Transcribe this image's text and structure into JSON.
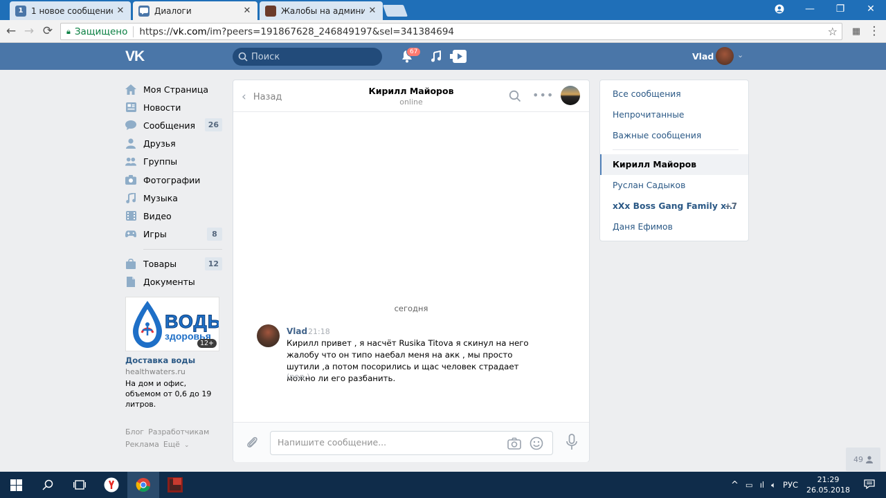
{
  "browser": {
    "tabs": [
      {
        "title": "1 новое сообщение",
        "favicon": "1"
      },
      {
        "title": "Диалоги",
        "favicon": "vk"
      },
      {
        "title": "Жалобы на администра",
        "favicon": "img"
      }
    ],
    "secure_label": "Защищено",
    "url_prefix": "https://",
    "url_host": "vk.com",
    "url_path": "/im?peers=191867628_246849197&sel=341384694"
  },
  "header": {
    "logo": "VK",
    "search_placeholder": "Поиск",
    "notifications_count": "67",
    "user_name": "Vlad"
  },
  "sidebar": {
    "items": [
      {
        "label": "Моя Страница",
        "icon": "home-icon",
        "count": ""
      },
      {
        "label": "Новости",
        "icon": "news-icon",
        "count": ""
      },
      {
        "label": "Сообщения",
        "icon": "messages-icon",
        "count": "26"
      },
      {
        "label": "Друзья",
        "icon": "friends-icon",
        "count": ""
      },
      {
        "label": "Группы",
        "icon": "groups-icon",
        "count": ""
      },
      {
        "label": "Фотографии",
        "icon": "camera-icon",
        "count": ""
      },
      {
        "label": "Музыка",
        "icon": "music-icon",
        "count": ""
      },
      {
        "label": "Видео",
        "icon": "video-icon",
        "count": ""
      },
      {
        "label": "Игры",
        "icon": "gamepad-icon",
        "count": "8"
      }
    ],
    "items2": [
      {
        "label": "Товары",
        "icon": "bag-icon",
        "count": "12"
      },
      {
        "label": "Документы",
        "icon": "document-icon",
        "count": ""
      }
    ],
    "ad": {
      "brand_line1": "ВОДЫ",
      "brand_line2": "здоровья",
      "age": "12+",
      "title": "Доставка воды",
      "domain": "healthwaters.ru",
      "text": "На дом и офис, объемом от 0,6 до 19 литров."
    },
    "footer": {
      "blog": "Блог",
      "developers": "Разработчикам",
      "ads": "Реклама",
      "more": "Ещё"
    }
  },
  "chat": {
    "back_label": "Назад",
    "peer_name": "Кирилл Майоров",
    "peer_status": "online",
    "date_separator": "сегодня",
    "message": {
      "author": "Vlad",
      "time": "21:18",
      "text": "Кирилл привет , я насчёт Rusika Titova я скинул на него жалобу что он типо наебал меня на акк , мы просто шутили ,а потом посорились и щас человек страдает можно ли его разбанить.",
      "edited": "(ред.)"
    },
    "input_placeholder": "Напишите сообщение..."
  },
  "right_menu": {
    "filters": [
      "Все сообщения",
      "Непрочитанные",
      "Важные сообщения"
    ],
    "dialogs": [
      {
        "name": "Кирилл Майоров",
        "count": ""
      },
      {
        "name": "Руслан Садыков",
        "count": ""
      },
      {
        "name": "xXx Boss Gang Family x...",
        "count": "+7"
      },
      {
        "name": "Даня Ефимов",
        "count": ""
      }
    ]
  },
  "online_count": "49",
  "taskbar": {
    "lang": "РУС",
    "time": "21:29",
    "date": "26.05.2018"
  },
  "colors": {
    "vk_blue": "#4a76a8",
    "link": "#2a5885",
    "taskbar": "#0f2c4a"
  }
}
